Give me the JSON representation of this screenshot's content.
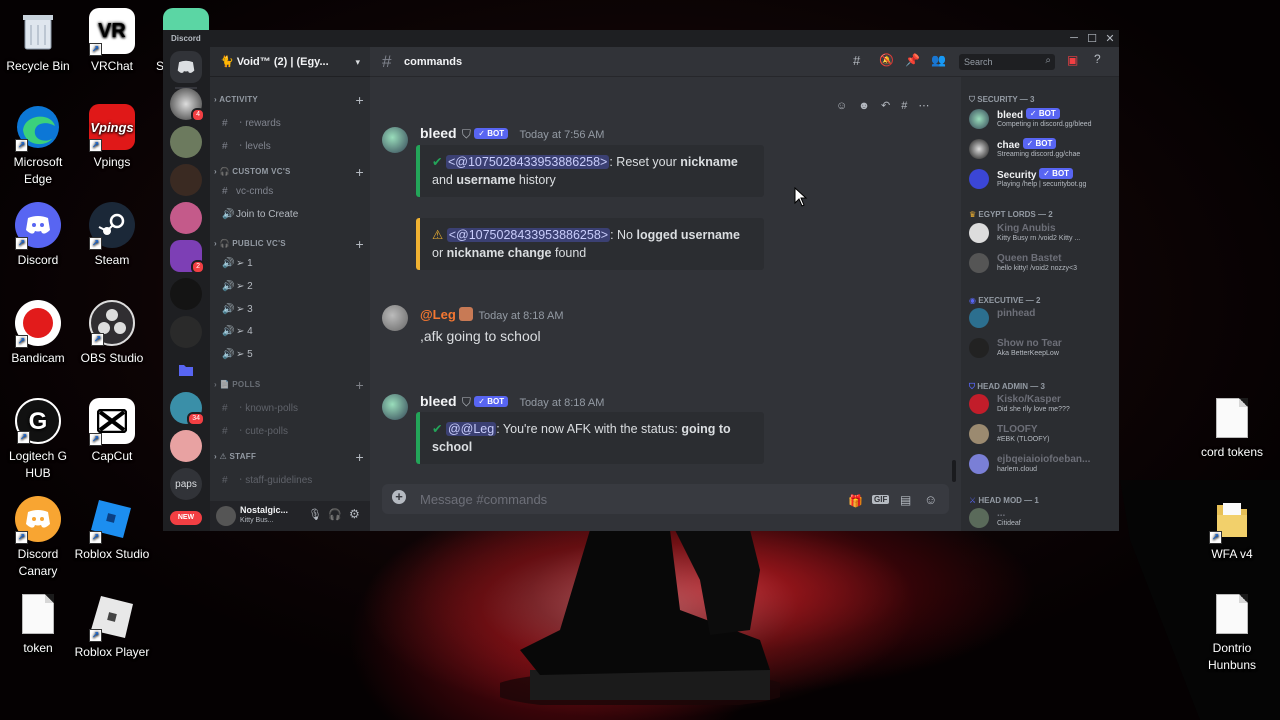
{
  "desktop": {
    "icons": [
      {
        "label": "Recycle Bin",
        "icon": "recycle-bin-icon"
      },
      {
        "label": "VRChat",
        "icon": "vrchat-icon",
        "glyph": "VR"
      },
      {
        "label": "Microsoft Edge",
        "icon": "edge-icon"
      },
      {
        "label": "Vpings",
        "icon": "vpings-icon",
        "glyph": "Vpings"
      },
      {
        "label": "Discord",
        "icon": "discord-icon"
      },
      {
        "label": "Steam",
        "icon": "steam-icon"
      },
      {
        "label": "Bandicam",
        "icon": "bandicam-icon"
      },
      {
        "label": "OBS Studio",
        "icon": "obs-icon"
      },
      {
        "label": "Logitech G HUB",
        "icon": "logitech-icon",
        "glyph": "G"
      },
      {
        "label": "CapCut",
        "icon": "capcut-icon"
      },
      {
        "label": "Discord Canary",
        "icon": "discord-canary-icon"
      },
      {
        "label": "Roblox Studio",
        "icon": "roblox-studio-icon"
      },
      {
        "label": "token",
        "icon": "text-file-icon"
      },
      {
        "label": "Roblox Player",
        "icon": "roblox-player-icon"
      },
      {
        "label": "cord tokens",
        "icon": "text-file-icon"
      },
      {
        "label": "WFA v4",
        "icon": "folder-icon"
      },
      {
        "label": "Dontrio Hunbuns",
        "icon": "text-file-icon"
      },
      {
        "label": "S",
        "icon": "partial-icon"
      }
    ]
  },
  "window": {
    "app_name": "Discord",
    "controls": {
      "minimize": "─",
      "maximize": "☐",
      "close": "✕"
    }
  },
  "server": {
    "name": "🐈 Void™ (2) | (Egy...",
    "categories": [
      {
        "label": "ACTIVITY"
      },
      {
        "label": "CUSTOM VC'S"
      },
      {
        "label": "PUBLIC VC'S"
      },
      {
        "label": "POLLS"
      },
      {
        "label": "STAFF"
      }
    ],
    "channels": {
      "rewards": "ㆍrewards",
      "levels": "ㆍlevels",
      "vc_cmds": "vc-cmds",
      "join_to_create": "Join to Create",
      "vc1": "➢ 1",
      "vc2": "➢ 2",
      "vc3": "➢ 3",
      "vc4": "➢ 4",
      "vc5": "➢ 5",
      "known_polls": "ㆍknown-polls",
      "cute_polls": "ㆍcute-polls",
      "staff_guidelines": "ㆍstaff-guidelines"
    },
    "guild_badges": {
      "g1": "4",
      "g2": "2",
      "g3": "34"
    },
    "paps_label": "paps",
    "new_label": "NEW"
  },
  "user": {
    "name": "Nostalgic...",
    "status": "Kitty Bus..."
  },
  "chat": {
    "channel": "commands",
    "search_placeholder": "Search",
    "composer_placeholder": "Message #commands",
    "gif_label": "GIF",
    "messages": [
      {
        "author": "bleed",
        "bot_tag": "✓ BOT",
        "time": "Today at 7:56 AM",
        "embeds": [
          {
            "mention": "<@1075028433953886258>",
            "text_a": ": Reset your ",
            "bold_a": "nickname",
            "text_b": " and ",
            "bold_b": "username",
            "text_c": " history"
          },
          {
            "mention": "<@1075028433953886258>",
            "text_a": ": No ",
            "bold_a": "logged username",
            "text_b": " or ",
            "bold_b": "nickname change",
            "text_c": " found"
          }
        ]
      },
      {
        "author": "@Leg",
        "time": "Today at 8:18 AM",
        "content": ",afk going to school"
      },
      {
        "author": "bleed",
        "bot_tag": "✓ BOT",
        "time": "Today at 8:18 AM",
        "embed": {
          "mention": "@@Leg",
          "text": ": You're now AFK with the status: ",
          "bold": "going to school"
        }
      }
    ]
  },
  "members": {
    "groups": [
      {
        "label": "SECURITY — 3"
      },
      {
        "label": "EGYPT LORDS — 2"
      },
      {
        "label": "EXECUTIVE — 2"
      },
      {
        "label": "HEAD ADMIN — 3"
      },
      {
        "label": "HEAD MOD — 1"
      }
    ],
    "list": [
      {
        "name": "bleed",
        "bot": "✓ BOT",
        "status": "Competing in discord.gg/bleed"
      },
      {
        "name": "chae",
        "bot": "✓ BOT",
        "status": "Streaming discord.gg/chae"
      },
      {
        "name": "Security",
        "bot": "✓ BOT",
        "status": "Playing /help | securitybot.gg"
      },
      {
        "name": "King Anubis",
        "status": "Kitty Busy rn /void2 Kitty ..."
      },
      {
        "name": "Queen Bastet",
        "status": "hello kitty! /void2 nozzy<3"
      },
      {
        "name": "pinhead",
        "status": ""
      },
      {
        "name": "Show no Tear",
        "status": "Aka BetterKeepLow"
      },
      {
        "name": "Kisko/Kasper",
        "status": "Did she rlly love me???"
      },
      {
        "name": "TLOOFY",
        "status": "#EBK (TLOOFY)"
      },
      {
        "name": "ejbqeiaioiofoeban...",
        "status": "harlem.cloud"
      },
      {
        "name": "...",
        "status": "Citideaf"
      }
    ]
  },
  "colors": {
    "accent": "#5865f2",
    "online": "#23a559",
    "dnd": "#f23f43",
    "success_bar": "#23a559",
    "warning_bar": "#f0b232",
    "leg_name": "#f57731"
  }
}
